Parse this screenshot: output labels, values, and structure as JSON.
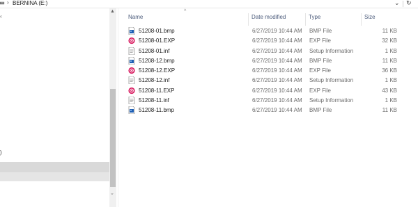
{
  "address_bar": {
    "path": "BERNINA (E:)",
    "chevron": "›",
    "dropdown_icon": "chevron-down-icon",
    "refresh_icon": "refresh-icon"
  },
  "nav_pane": {
    "brace_text": ")"
  },
  "file_list": {
    "columns": {
      "name": "Name",
      "date_modified": "Date modified",
      "type": "Type",
      "size": "Size"
    },
    "files": [
      {
        "name": "51208-01.bmp",
        "date": "6/27/2019 10:44 AM",
        "type": "BMP File",
        "size": "11 KB",
        "icon": "bmp"
      },
      {
        "name": "51208-01.EXP",
        "date": "6/27/2019 10:44 AM",
        "type": "EXP File",
        "size": "32 KB",
        "icon": "exp"
      },
      {
        "name": "51208-01.inf",
        "date": "6/27/2019 10:44 AM",
        "type": "Setup Information",
        "size": "1 KB",
        "icon": "inf"
      },
      {
        "name": "51208-12.bmp",
        "date": "6/27/2019 10:44 AM",
        "type": "BMP File",
        "size": "11 KB",
        "icon": "bmp"
      },
      {
        "name": "51208-12.EXP",
        "date": "6/27/2019 10:44 AM",
        "type": "EXP File",
        "size": "36 KB",
        "icon": "exp"
      },
      {
        "name": "51208-12.inf",
        "date": "6/27/2019 10:44 AM",
        "type": "Setup Information",
        "size": "1 KB",
        "icon": "inf"
      },
      {
        "name": "51208-11.EXP",
        "date": "6/27/2019 10:44 AM",
        "type": "EXP File",
        "size": "43 KB",
        "icon": "exp"
      },
      {
        "name": "51208-11.inf",
        "date": "6/27/2019 10:44 AM",
        "type": "Setup Information",
        "size": "1 KB",
        "icon": "inf"
      },
      {
        "name": "51208-11.bmp",
        "date": "6/27/2019 10:44 AM",
        "type": "BMP File",
        "size": "11 KB",
        "icon": "bmp"
      }
    ]
  },
  "colors": {
    "header_text": "#4a5a7a",
    "secondary_text": "#6d6d6d",
    "exp_icon": "#d81b60",
    "bmp_icon": "#1e5fb4",
    "selection": "#d9d9d9"
  }
}
